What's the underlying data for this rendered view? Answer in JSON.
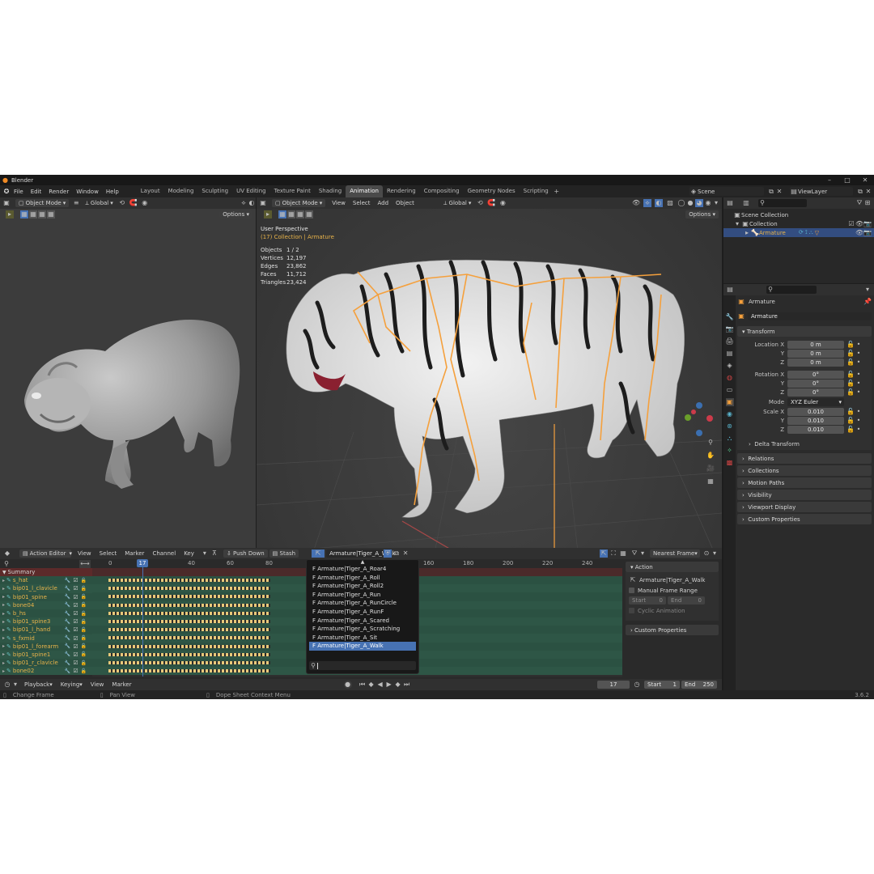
{
  "app": {
    "title": "Blender",
    "menus": [
      "File",
      "Edit",
      "Render",
      "Window",
      "Help"
    ],
    "workspaces": [
      "Layout",
      "Modeling",
      "Sculpting",
      "UV Editing",
      "Texture Paint",
      "Shading",
      "Animation",
      "Rendering",
      "Compositing",
      "Geometry Nodes",
      "Scripting"
    ],
    "active_workspace": "Animation",
    "scene": "Scene",
    "view_layer": "ViewLayer"
  },
  "left_viewport": {
    "mode": "Object Mode",
    "orientation": "Global",
    "options": "Options"
  },
  "main_viewport": {
    "mode": "Object Mode",
    "menus": [
      "View",
      "Select",
      "Add",
      "Object"
    ],
    "orientation": "Global",
    "options": "Options",
    "perspective": "User Perspective",
    "collection": "(17) Collection | Armature",
    "stats": [
      {
        "label": "Objects",
        "value": "1 / 2"
      },
      {
        "label": "Vertices",
        "value": "12,197"
      },
      {
        "label": "Edges",
        "value": "23,862"
      },
      {
        "label": "Faces",
        "value": "11,712"
      },
      {
        "label": "Triangles",
        "value": "23,424"
      }
    ]
  },
  "outliner": {
    "scene_collection": "Scene Collection",
    "collection": "Collection",
    "armature": "Armature"
  },
  "properties": {
    "object_name": "Armature",
    "data_name": "Armature",
    "transform_label": "Transform",
    "location_x_label": "Location X",
    "rotation_x_label": "Rotation X",
    "scale_x_label": "Scale X",
    "y_label": "Y",
    "z_label": "Z",
    "location": [
      "0 m",
      "0 m",
      "0 m"
    ],
    "rotation": [
      "0°",
      "0°",
      "0°"
    ],
    "mode_label": "Mode",
    "mode_value": "XYZ Euler",
    "scale": [
      "0.010",
      "0.010",
      "0.010"
    ],
    "delta_transform": "Delta Transform",
    "sections": [
      "Relations",
      "Collections",
      "Motion Paths",
      "Visibility",
      "Viewport Display",
      "Custom Properties"
    ]
  },
  "action_editor": {
    "editor_mode": "Action Editor",
    "menus": [
      "View",
      "Select",
      "Marker",
      "Channel",
      "Key"
    ],
    "push_down": "Push Down",
    "stash": "Stash",
    "action_name": "Armature|Tiger_A_Walk",
    "snapping": "Nearest Frame",
    "current_frame": "17",
    "ruler_ticks": [
      "0",
      "40",
      "60",
      "80",
      "160",
      "180",
      "200",
      "220",
      "240"
    ],
    "summary": "Summary",
    "channels": [
      "s_hat",
      "bip01_l_clavicle",
      "bip01_spine",
      "bone04",
      "b_hs",
      "bip01_spine3",
      "bip01_l_hand",
      "s_fxmid",
      "bip01_l_forearm",
      "bip01_spine1",
      "bip01_r_clavicle",
      "bone02"
    ],
    "dropdown_items": [
      "F Armature|Tiger_A_Roar4",
      "F Armature|Tiger_A_Roll",
      "F Armature|Tiger_A_Roll2",
      "F Armature|Tiger_A_Run",
      "F Armature|Tiger_A_RunCircle",
      "F Armature|Tiger_A_RunF",
      "F Armature|Tiger_A_Scared",
      "F Armature|Tiger_A_Scratching",
      "F Armature|Tiger_A_Sit",
      "F Armature|Tiger_A_Walk"
    ],
    "dropdown_selected": "F Armature|Tiger_A_Walk",
    "sidebar": {
      "action_label": "Action",
      "action_name": "Armature|Tiger_A_Walk",
      "manual_frame_range": "Manual Frame Range",
      "start_label": "Start",
      "start_value": "0",
      "end_label": "End",
      "end_value": "0",
      "cyclic": "Cyclic Animation",
      "custom_properties": "Custom Properties"
    }
  },
  "timeline": {
    "menus": [
      "Playback",
      "Keying",
      "View",
      "Marker"
    ],
    "frame": "17",
    "start_label": "Start",
    "start": "1",
    "end_label": "End",
    "end": "250"
  },
  "status_bar": {
    "change_frame": "Change Frame",
    "pan_view": "Pan View",
    "context_menu": "Dope Sheet Context Menu",
    "version": "3.6.2"
  },
  "colors": {
    "accent": "#4772b3",
    "bone_orange": "#f5a03c",
    "channel_green": "#2e5e4e",
    "keyframe": "#e8c97a",
    "playhead": "#4772b3"
  }
}
